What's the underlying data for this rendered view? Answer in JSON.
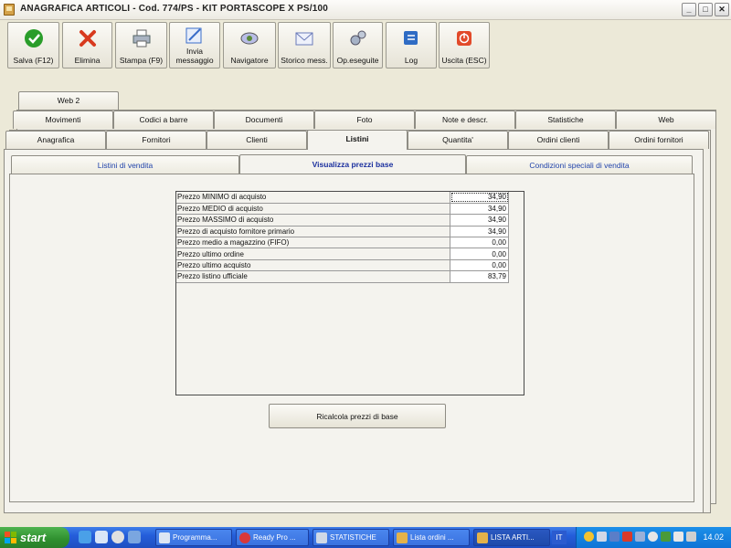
{
  "window": {
    "title": "ANAGRAFICA ARTICOLI - Cod. 774/PS - KIT PORTASCOPE X PS/100",
    "controls": {
      "minimize": "_",
      "maximize": "□",
      "close": "✕"
    }
  },
  "toolbar": [
    {
      "label": "Salva (F12)",
      "icon": "check-icon",
      "color": "#2a9d2a"
    },
    {
      "label": "Elimina",
      "icon": "delete-x-icon",
      "color": "#d83a1e"
    },
    {
      "label": "Stampa (F9)",
      "icon": "printer-icon",
      "color": "#6f7f94"
    },
    {
      "label": "Invia\nmessaggio",
      "icon": "send-message-icon",
      "color": "#3a6dc9"
    },
    {
      "label": "Navigatore",
      "icon": "navigator-icon",
      "color": "#7a7fbf"
    },
    {
      "label": "Storico mess.",
      "icon": "message-history-icon",
      "color": "#8a99c8"
    },
    {
      "label": "Op.eseguite",
      "icon": "gears-icon",
      "color": "#8c9ab0"
    },
    {
      "label": "Log",
      "icon": "log-icon",
      "color": "#2f6cc4"
    },
    {
      "label": "Uscita (ESC)",
      "icon": "exit-icon",
      "color": "#e24a2a"
    }
  ],
  "tabs": {
    "row3": [
      "Web 2"
    ],
    "row2": [
      "Movimenti",
      "Codici a barre",
      "Documenti",
      "Foto",
      "Note e descr.",
      "Statistiche",
      "Web"
    ],
    "row1": [
      "Anagrafica",
      "Fornitori",
      "Clienti",
      "Listini",
      "Quantita'",
      "Ordini clienti",
      "Ordini fornitori"
    ],
    "active": "Listini"
  },
  "subtabs": {
    "items": [
      "Listini di vendita",
      "Visualizza prezzi base",
      "Condizioni speciali di vendita"
    ],
    "active": "Visualizza prezzi base"
  },
  "prices": [
    {
      "label": "Prezzo MINIMO di acquisto",
      "value": "34,90"
    },
    {
      "label": "Prezzo MEDIO di acquisto",
      "value": "34,90"
    },
    {
      "label": "Prezzo MASSIMO di acquisto",
      "value": "34,90"
    },
    {
      "label": "Prezzo di acquisto fornitore primario",
      "value": "34,90"
    },
    {
      "label": "Prezzo medio a magazzino (FIFO)",
      "value": "0,00"
    },
    {
      "label": "Prezzo ultimo ordine",
      "value": "0,00"
    },
    {
      "label": "Prezzo ultimo acquisto",
      "value": "0,00"
    },
    {
      "label": "Prezzo listino ufficiale",
      "value": "83,79"
    }
  ],
  "recalc_button": "Ricalcola prezzi di base",
  "taskbar": {
    "start": "start",
    "items": [
      {
        "label": "Programma...",
        "icon": "window-icon"
      },
      {
        "label": "Ready Pro ...",
        "icon": "strawberry-icon"
      },
      {
        "label": "STATISTICHE",
        "icon": "chart-window-icon"
      },
      {
        "label": "Lista ordini ...",
        "icon": "list-window-icon"
      },
      {
        "label": "LISTA ARTI...",
        "icon": "list-window-icon"
      }
    ],
    "language": "IT",
    "clock": "14.02"
  }
}
